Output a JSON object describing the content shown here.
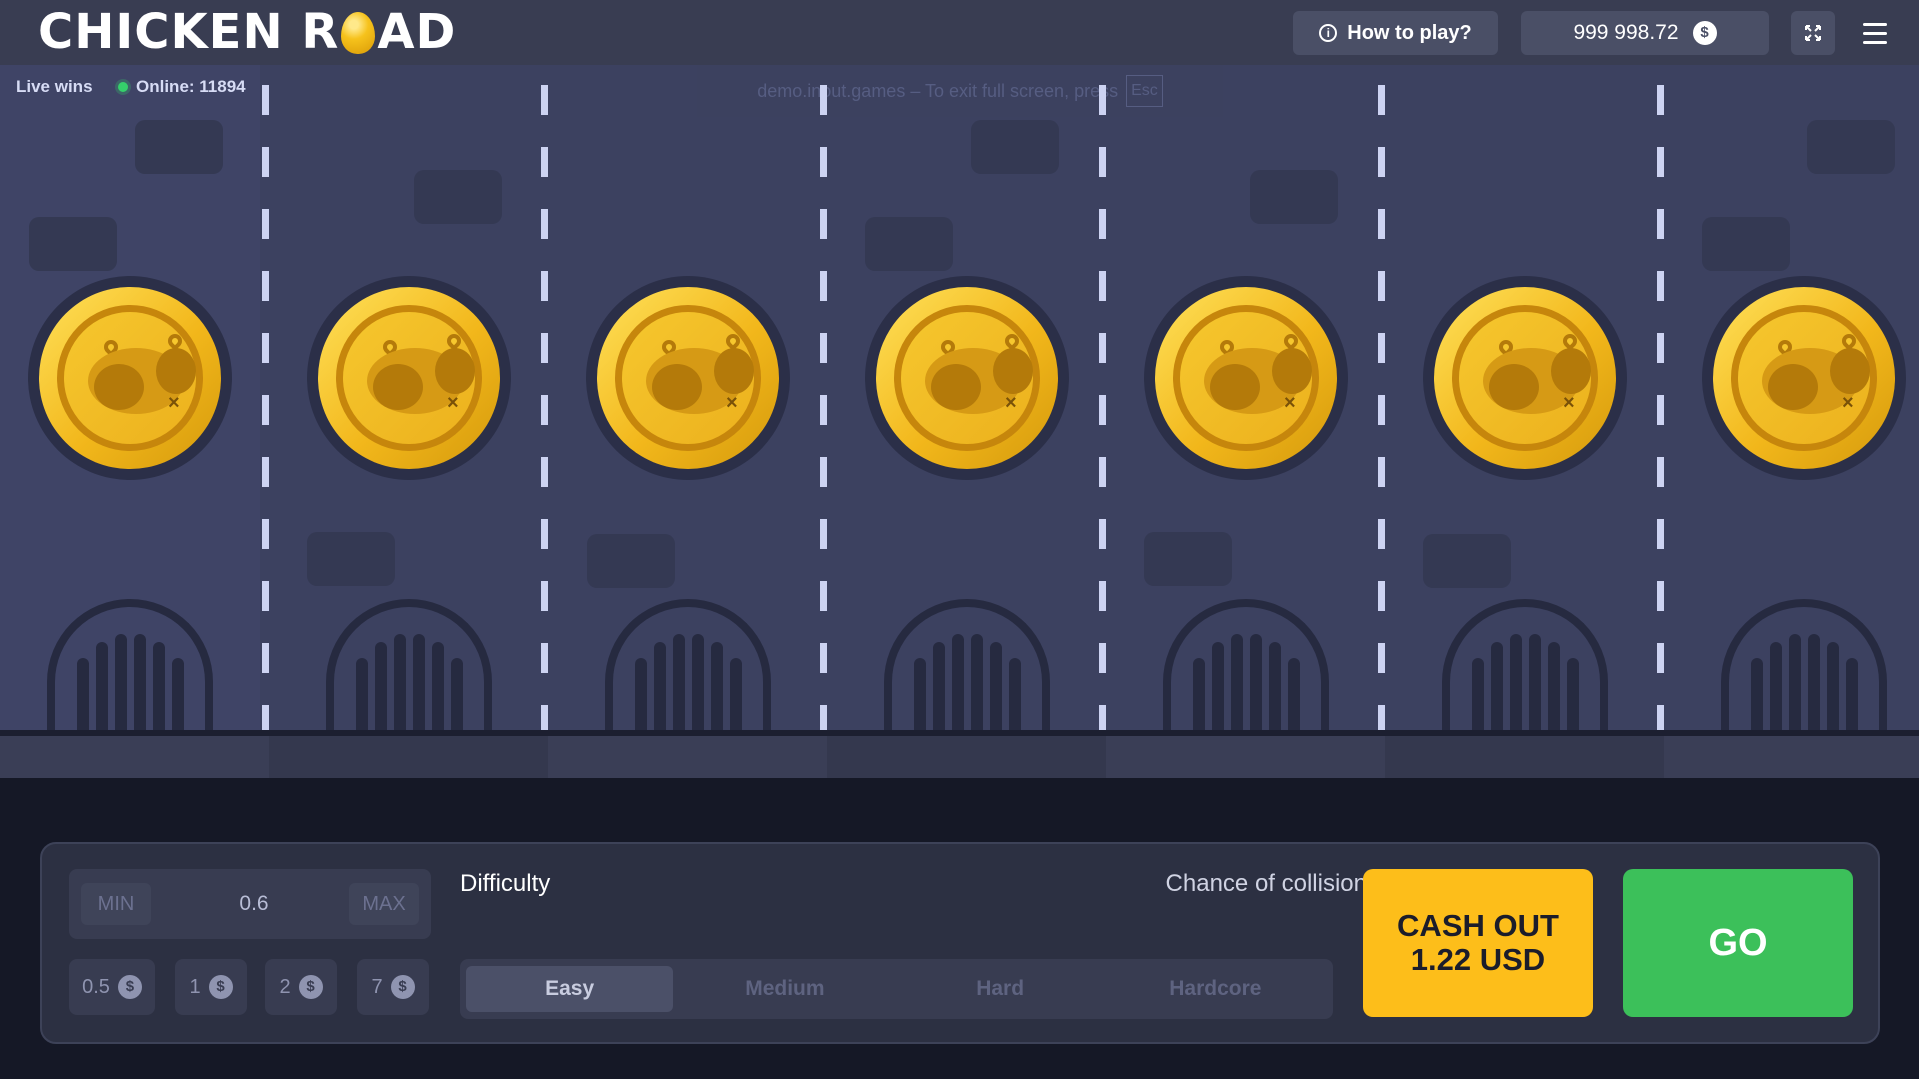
{
  "header": {
    "logo_left": "CHICKEN R",
    "logo_right": "AD",
    "how_to_play": "How to play?",
    "balance": "999 998.72",
    "currency_symbol": "$"
  },
  "game": {
    "live_wins": "Live wins",
    "online": "Online: 11894",
    "fullscreen_notice": "demo.inout.games – To exit full screen, press",
    "fullscreen_key": "Esc",
    "lane_count": 7,
    "chicken_status_mark": "×"
  },
  "controls": {
    "bet": {
      "min_label": "MIN",
      "value": "0.6",
      "max_label": "MAX"
    },
    "chips": [
      "0.5",
      "1",
      "2",
      "7"
    ],
    "chip_currency": "$",
    "difficulty_label": "Difficulty",
    "collision_label": "Chance of collision",
    "difficulties": [
      "Easy",
      "Medium",
      "Hard",
      "Hardcore"
    ],
    "selected_difficulty": "Easy",
    "cashout_line1": "CASH OUT",
    "cashout_line2": "1.22 USD",
    "go_label": "GO"
  },
  "colors": {
    "cashout": "#fdbe1a",
    "go": "#3cc05a",
    "online_dot": "#35d06b"
  }
}
